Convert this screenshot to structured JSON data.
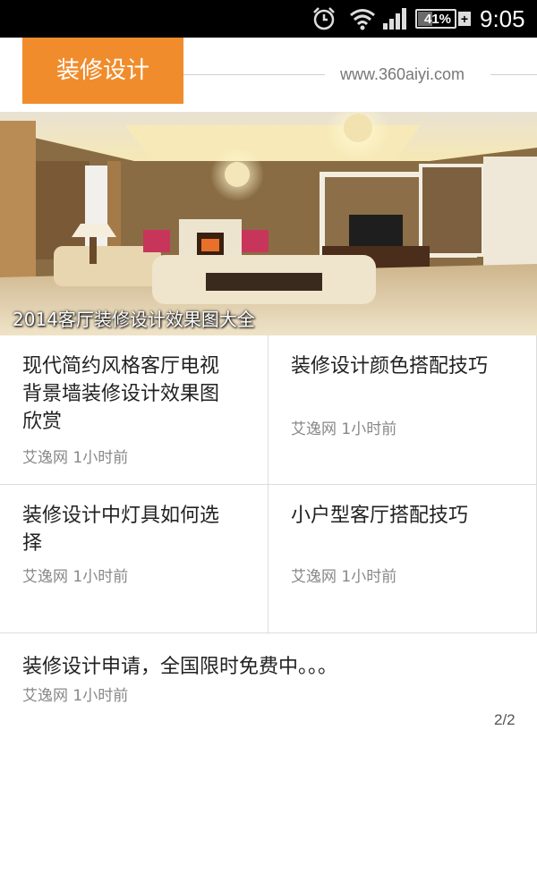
{
  "status_bar": {
    "battery_percent": "41%",
    "battery_level": 0.41,
    "battery_charging_symbol": "+",
    "time": "9:05",
    "icons": [
      "alarm-clock-icon",
      "wifi-icon",
      "cell-signal-icon",
      "battery-icon"
    ]
  },
  "header": {
    "title": "装修设计",
    "site_url": "www.360aiyi.com",
    "accent_color": "#f08c2c"
  },
  "hero": {
    "caption": "2014客厅装修设计效果图大全"
  },
  "articles": [
    {
      "title": "现代简约风格客厅电视背景墙装修设计效果图欣赏",
      "source": "艾逸网",
      "time": "1小时前"
    },
    {
      "title": "装修设计颜色搭配技巧",
      "source": "艾逸网",
      "time": "1小时前"
    },
    {
      "title": "装修设计中灯具如何选择",
      "source": "艾逸网",
      "time": "1小时前"
    },
    {
      "title": "小户型客厅搭配技巧",
      "source": "艾逸网",
      "time": "1小时前"
    }
  ],
  "featured": {
    "title": "装修设计申请，全国限时免费中。。。",
    "source": "艾逸网",
    "time": "1小时前"
  },
  "pager": "2/2"
}
